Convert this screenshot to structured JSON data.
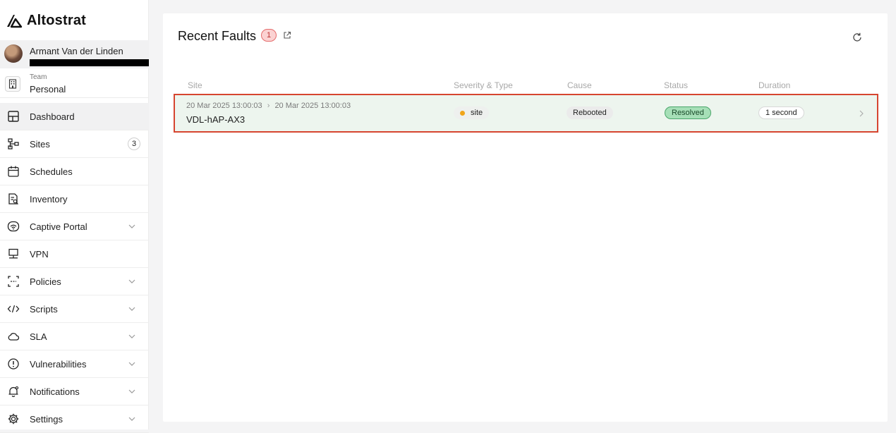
{
  "brand": {
    "name": "Altostrat"
  },
  "user": {
    "name": "Armant Van der Linden"
  },
  "team": {
    "label": "Team",
    "value": "Personal"
  },
  "nav": [
    {
      "label": "Dashboard",
      "icon": "dashboard-icon",
      "active": true
    },
    {
      "label": "Sites",
      "icon": "sites-icon",
      "count": "3"
    },
    {
      "label": "Schedules",
      "icon": "calendar-icon"
    },
    {
      "label": "Inventory",
      "icon": "inventory-icon"
    },
    {
      "label": "Captive Portal",
      "icon": "wifi-icon",
      "expandable": true
    },
    {
      "label": "VPN",
      "icon": "vpn-icon"
    },
    {
      "label": "Policies",
      "icon": "policies-icon",
      "expandable": true
    },
    {
      "label": "Scripts",
      "icon": "code-icon",
      "expandable": true
    },
    {
      "label": "SLA",
      "icon": "cloud-icon",
      "expandable": true
    },
    {
      "label": "Vulnerabilities",
      "icon": "alert-icon",
      "expandable": true
    },
    {
      "label": "Notifications",
      "icon": "bell-icon",
      "expandable": true
    },
    {
      "label": "Settings",
      "icon": "gear-icon",
      "expandable": true
    }
  ],
  "faults": {
    "title": "Recent Faults",
    "count": "1",
    "columns": [
      "Site",
      "Severity & Type",
      "Cause",
      "Status",
      "Duration"
    ],
    "rows": [
      {
        "start": "20 Mar 2025 13:00:03",
        "end": "20 Mar 2025 13:00:03",
        "site": "VDL-hAP-AX3",
        "type": "site",
        "cause": "Rebooted",
        "status": "Resolved",
        "duration": "1 second"
      }
    ]
  },
  "colors": {
    "accent_highlight": "#d6452f",
    "resolved_bg": "#a6dfb7",
    "severity_dot": "#f0a51a",
    "fault_badge_bg": "#fbd2d2"
  }
}
